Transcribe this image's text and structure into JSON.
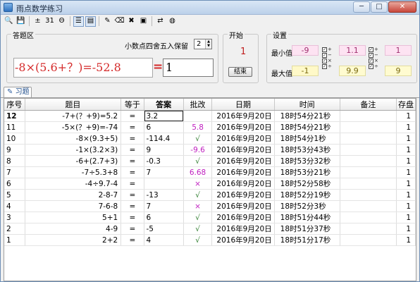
{
  "window": {
    "title": "雨点数学练习",
    "minimize": "─",
    "maximize": "□",
    "close": "✕"
  },
  "toolbar": {
    "buttons": [
      {
        "icon": "print-preview-icon",
        "glyph": "🔍"
      },
      {
        "icon": "save-icon",
        "glyph": "💾"
      },
      {
        "icon": "calculator-icon",
        "glyph": "±"
      },
      {
        "icon": "number-icon",
        "glyph": "31"
      },
      {
        "icon": "circle-mode-icon",
        "glyph": "Θ"
      },
      {
        "icon": "list-mode-icon",
        "glyph": "☰"
      },
      {
        "icon": "grid-mode-icon",
        "glyph": "▤"
      },
      {
        "icon": "pen-icon",
        "glyph": "✎"
      },
      {
        "icon": "eraser-icon",
        "glyph": "⌫"
      },
      {
        "icon": "delete-icon",
        "glyph": "✖"
      },
      {
        "icon": "stamp-icon",
        "glyph": "▣"
      },
      {
        "icon": "toggle-icon",
        "glyph": "⇄"
      },
      {
        "icon": "globe-icon",
        "glyph": "◍"
      }
    ]
  },
  "answer_area": {
    "group_label": "答题区",
    "round_label": "小数点四舍五入保留",
    "round_value": "2",
    "question": "-8×(5.6+？)=-52.8",
    "equals": "=",
    "answer_value": "1"
  },
  "start": {
    "group_label": "开始",
    "count": "1",
    "end_button": "结束"
  },
  "settings": {
    "group_label": "设置",
    "min_label": "最小值",
    "max_label": "最大值",
    "min_value": "-9",
    "max_value": "-1",
    "dec_min": "1.1",
    "dec_max": "9.9",
    "int_min": "1",
    "int_max": "9",
    "ops_col1": [
      "+",
      "−",
      "×",
      "÷"
    ],
    "ops_col2": [
      "+",
      "−",
      "×",
      "÷"
    ]
  },
  "tab": {
    "label": "习题"
  },
  "table": {
    "headers": [
      "序号",
      "题目",
      "等于",
      "答案",
      "批改",
      "日期",
      "时间",
      "备注",
      "存盘"
    ],
    "rows": [
      {
        "num": "12",
        "question": "-7+(？+9)=5.2",
        "eq": "=",
        "answer": "3.2",
        "mark": "",
        "mark_type": "none",
        "date": "2016年9月20日",
        "time": "18时54分21秒",
        "note": "",
        "saved": "1"
      },
      {
        "num": "11",
        "question": "-5×(？+9)=-74",
        "eq": "=",
        "answer": "6",
        "mark": "5.8",
        "mark_type": "bad",
        "date": "2016年9月20日",
        "time": "18时54分21秒",
        "note": "",
        "saved": "1"
      },
      {
        "num": "10",
        "question": "-8×(9.3+5)",
        "eq": "=",
        "answer": "-114.4",
        "mark": "√",
        "mark_type": "ok",
        "date": "2016年9月20日",
        "time": "18时54分1秒",
        "note": "",
        "saved": "1"
      },
      {
        "num": "9",
        "question": "-1×(3.2×3)",
        "eq": "=",
        "answer": "9",
        "mark": "-9.6",
        "mark_type": "bad",
        "date": "2016年9月20日",
        "time": "18时53分43秒",
        "note": "",
        "saved": "1"
      },
      {
        "num": "8",
        "question": "-6+(2.7+3)",
        "eq": "=",
        "answer": "-0.3",
        "mark": "√",
        "mark_type": "ok",
        "date": "2016年9月20日",
        "time": "18时53分32秒",
        "note": "",
        "saved": "1"
      },
      {
        "num": "7",
        "question": "-7÷5.3+8",
        "eq": "=",
        "answer": "7",
        "mark": "6.68",
        "mark_type": "bad",
        "date": "2016年9月20日",
        "time": "18时53分21秒",
        "note": "",
        "saved": "1"
      },
      {
        "num": "6",
        "question": "-4÷9.7-4",
        "eq": "=",
        "answer": "",
        "mark": "×",
        "mark_type": "bad",
        "date": "2016年9月20日",
        "time": "18时52分58秒",
        "note": "",
        "saved": "1"
      },
      {
        "num": "5",
        "question": "2-8-7",
        "eq": "=",
        "answer": "-13",
        "mark": "√",
        "mark_type": "ok",
        "date": "2016年9月20日",
        "time": "18时52分19秒",
        "note": "",
        "saved": "1"
      },
      {
        "num": "4",
        "question": "7-6-8",
        "eq": "=",
        "answer": "7",
        "mark": "×",
        "mark_type": "bad",
        "date": "2016年9月20日",
        "time": "18时52分3秒",
        "note": "",
        "saved": "1"
      },
      {
        "num": "3",
        "question": "5+1",
        "eq": "=",
        "answer": "6",
        "mark": "√",
        "mark_type": "ok",
        "date": "2016年9月20日",
        "time": "18时51分44秒",
        "note": "",
        "saved": "1"
      },
      {
        "num": "2",
        "question": "4-9",
        "eq": "=",
        "answer": "-5",
        "mark": "√",
        "mark_type": "ok",
        "date": "2016年9月20日",
        "time": "18时51分37秒",
        "note": "",
        "saved": "1"
      },
      {
        "num": "1",
        "question": "2+2",
        "eq": "=",
        "answer": "4",
        "mark": "√",
        "mark_type": "ok",
        "date": "2016年9月20日",
        "time": "18时51分17秒",
        "note": "",
        "saved": "1"
      }
    ]
  }
}
